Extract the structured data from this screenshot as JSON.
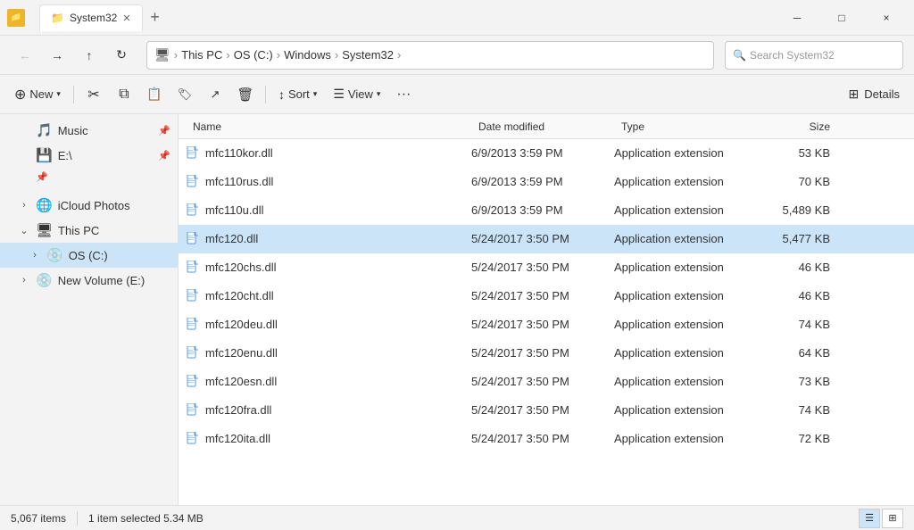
{
  "titleBar": {
    "icon": "📁",
    "title": "System32",
    "closeLabel": "×",
    "minimizeLabel": "─",
    "maximizeLabel": "□",
    "newTabLabel": "+"
  },
  "navBar": {
    "backLabel": "←",
    "forwardLabel": "→",
    "upLabel": "↑",
    "refreshLabel": "↻",
    "monitorIcon": "🖥",
    "pathSegments": [
      "This PC",
      "OS (C:)",
      "Windows",
      "System32"
    ],
    "searchPlaceholder": "Search System32"
  },
  "toolbar": {
    "newLabel": "New",
    "sortLabel": "Sort",
    "viewLabel": "View",
    "detailsLabel": "Details",
    "moreLabel": "···"
  },
  "sidebar": {
    "items": [
      {
        "id": "music",
        "label": "Music",
        "icon": "🎵",
        "indent": 0,
        "pinned": true,
        "expanded": false
      },
      {
        "id": "edrive",
        "label": "E:\\",
        "icon": "💾",
        "indent": 0,
        "pinned": true,
        "expanded": false
      },
      {
        "id": "icloud",
        "label": "iCloud Photos",
        "icon": "🌐",
        "indent": 0,
        "pinned": false,
        "expanded": false,
        "hasArrow": true
      },
      {
        "id": "thispc",
        "label": "This PC",
        "icon": "🖥",
        "indent": 0,
        "pinned": false,
        "expanded": true,
        "hasArrow": true
      },
      {
        "id": "osc",
        "label": "OS (C:)",
        "icon": "💿",
        "indent": 1,
        "pinned": false,
        "expanded": false,
        "hasArrow": true,
        "selected": true
      },
      {
        "id": "newvol",
        "label": "New Volume (E:)",
        "icon": "💿",
        "indent": 0,
        "pinned": false,
        "expanded": false,
        "hasArrow": true
      }
    ]
  },
  "fileList": {
    "columns": {
      "name": "Name",
      "dateModified": "Date modified",
      "type": "Type",
      "size": "Size"
    },
    "files": [
      {
        "name": "mfc110kor.dll",
        "date": "6/9/2013 3:59 PM",
        "type": "Application extension",
        "size": "53 KB",
        "selected": false
      },
      {
        "name": "mfc110rus.dll",
        "date": "6/9/2013 3:59 PM",
        "type": "Application extension",
        "size": "70 KB",
        "selected": false
      },
      {
        "name": "mfc110u.dll",
        "date": "6/9/2013 3:59 PM",
        "type": "Application extension",
        "size": "5,489 KB",
        "selected": false
      },
      {
        "name": "mfc120.dll",
        "date": "5/24/2017 3:50 PM",
        "type": "Application extension",
        "size": "5,477 KB",
        "selected": true
      },
      {
        "name": "mfc120chs.dll",
        "date": "5/24/2017 3:50 PM",
        "type": "Application extension",
        "size": "46 KB",
        "selected": false
      },
      {
        "name": "mfc120cht.dll",
        "date": "5/24/2017 3:50 PM",
        "type": "Application extension",
        "size": "46 KB",
        "selected": false
      },
      {
        "name": "mfc120deu.dll",
        "date": "5/24/2017 3:50 PM",
        "type": "Application extension",
        "size": "74 KB",
        "selected": false
      },
      {
        "name": "mfc120enu.dll",
        "date": "5/24/2017 3:50 PM",
        "type": "Application extension",
        "size": "64 KB",
        "selected": false
      },
      {
        "name": "mfc120esn.dll",
        "date": "5/24/2017 3:50 PM",
        "type": "Application extension",
        "size": "73 KB",
        "selected": false
      },
      {
        "name": "mfc120fra.dll",
        "date": "5/24/2017 3:50 PM",
        "type": "Application extension",
        "size": "74 KB",
        "selected": false
      },
      {
        "name": "mfc120ita.dll",
        "date": "5/24/2017 3:50 PM",
        "type": "Application extension",
        "size": "72 KB",
        "selected": false
      }
    ]
  },
  "statusBar": {
    "itemCount": "5,067 items",
    "selectedInfo": "1 item selected  5.34 MB"
  }
}
